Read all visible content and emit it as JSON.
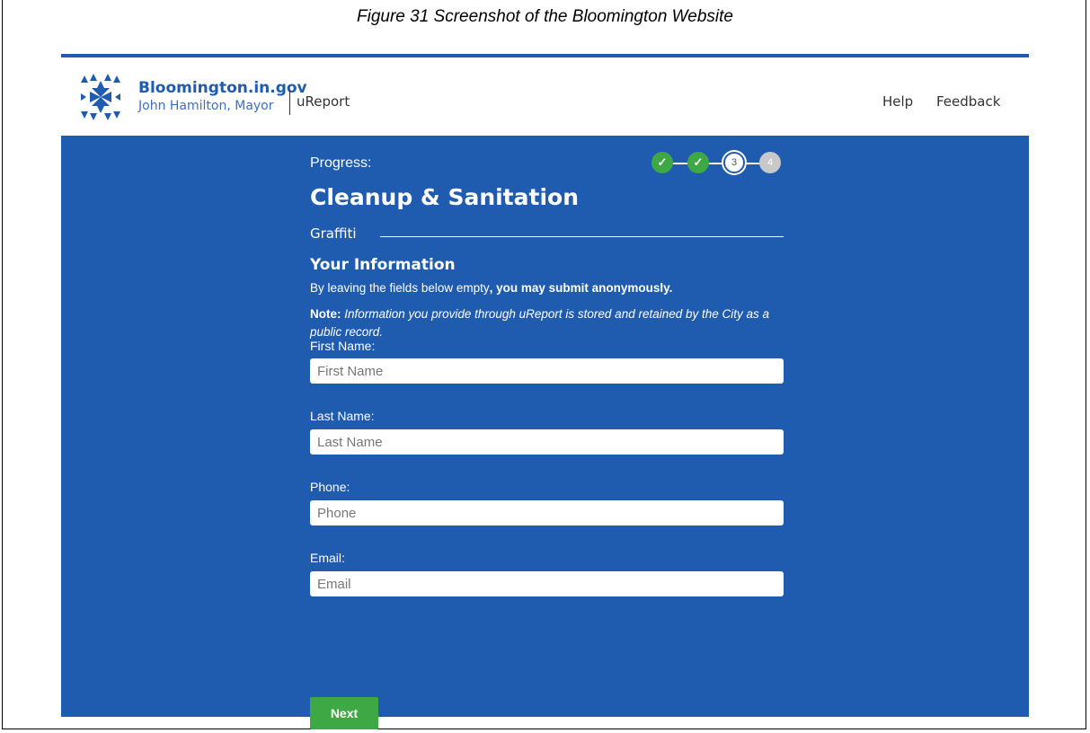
{
  "caption": "Figure 31 Screenshot of the Bloomington Website",
  "header": {
    "brand_name": "Bloomington.in.gov",
    "brand_sub": "John Hamilton, Mayor",
    "app_name": "uReport",
    "nav": [
      "Help",
      "Feedback"
    ]
  },
  "progress": {
    "label": "Progress:",
    "steps": [
      {
        "state": "done",
        "label": "✓"
      },
      {
        "state": "done",
        "label": "✓"
      },
      {
        "state": "current",
        "label": "3"
      },
      {
        "state": "future",
        "label": "4"
      }
    ]
  },
  "category": "Cleanup & Sanitation",
  "subcategory": "Graffiti",
  "section": {
    "title": "Your Information",
    "anon_prefix": "By leaving the fields below empty",
    "anon_bold": ", you may submit anonymously.",
    "note_label": "Note:",
    "note_text": "Information you provide through uReport is stored and retained by the City as a public record."
  },
  "fields": {
    "first_name": {
      "label": "First Name:",
      "placeholder": "First Name",
      "value": ""
    },
    "last_name": {
      "label": "Last Name:",
      "placeholder": "Last Name",
      "value": ""
    },
    "phone": {
      "label": "Phone:",
      "placeholder": "Phone",
      "value": ""
    },
    "email": {
      "label": "Email:",
      "placeholder": "Email",
      "value": ""
    }
  },
  "next_label": "Next",
  "colors": {
    "brand_blue": "#1f5cb0",
    "step_done": "#3ea845",
    "button_green": "#3ea845"
  }
}
